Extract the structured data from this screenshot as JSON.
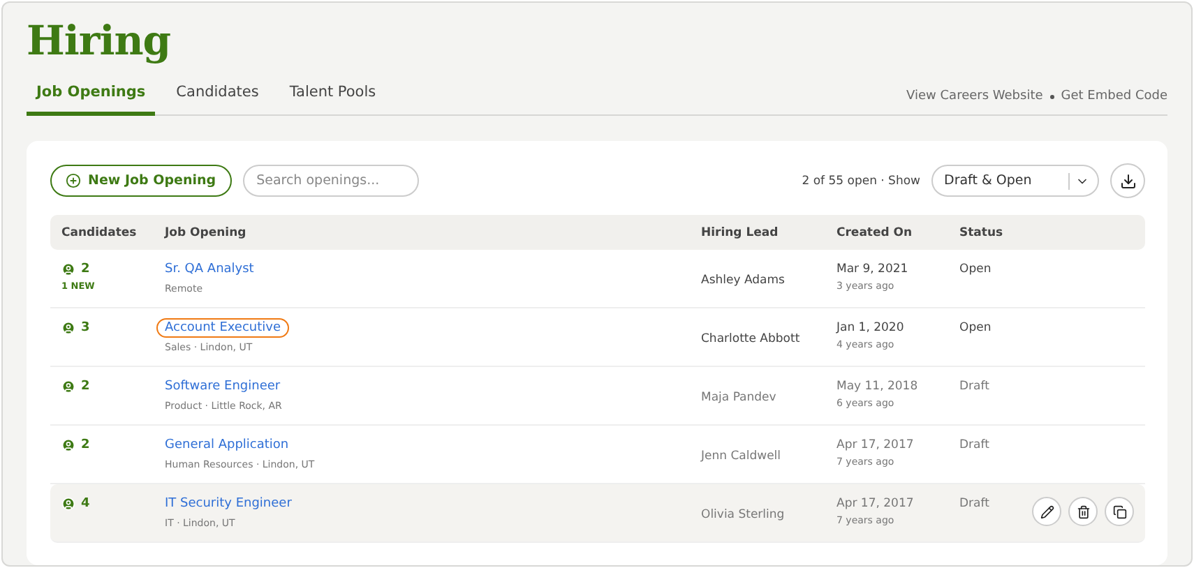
{
  "title": "Hiring",
  "tabs": [
    {
      "label": "Job Openings",
      "selected": true
    },
    {
      "label": "Candidates",
      "selected": false
    },
    {
      "label": "Talent Pools",
      "selected": false
    }
  ],
  "header_links": [
    "View Careers Website",
    "Get Embed Code"
  ],
  "new_button": "New Job Opening",
  "search": {
    "placeholder": "Search openings..."
  },
  "summary": "2 of 55 open · Show",
  "filter": {
    "value": "Draft & Open"
  },
  "table": {
    "columns": [
      "Candidates",
      "Job Opening",
      "Hiring Lead",
      "Created On",
      "Status"
    ],
    "rows": [
      {
        "count": "2",
        "badge": "1 NEW",
        "title": "Sr. QA Analyst",
        "subtitle": "Remote",
        "lead": "Ashley Adams",
        "date": "Mar 9, 2021",
        "ago": "3 years ago",
        "status": "Open",
        "active": true,
        "focused": false,
        "hovered": false
      },
      {
        "count": "3",
        "title": "Account Executive",
        "subtitle": "Sales · Lindon, UT",
        "lead": "Charlotte Abbott",
        "date": "Jan 1, 2020",
        "ago": "4 years ago",
        "status": "Open",
        "active": true,
        "focused": true,
        "hovered": false
      },
      {
        "count": "2",
        "title": "Software Engineer",
        "subtitle": "Product · Little Rock, AR",
        "lead": "Maja Pandev",
        "date": "May 11, 2018",
        "ago": "6 years ago",
        "status": "Draft",
        "active": false,
        "focused": false,
        "hovered": false
      },
      {
        "count": "2",
        "title": "General Application",
        "subtitle": "Human Resources · Lindon, UT",
        "lead": "Jenn Caldwell",
        "date": "Apr 17, 2017",
        "ago": "7 years ago",
        "status": "Draft",
        "active": false,
        "focused": false,
        "hovered": false
      },
      {
        "count": "4",
        "title": "IT Security Engineer",
        "subtitle": "IT · Lindon, UT",
        "lead": "Olivia Sterling",
        "date": "Apr 17, 2017",
        "ago": "7 years ago",
        "status": "Draft",
        "active": false,
        "focused": false,
        "hovered": true
      }
    ]
  }
}
